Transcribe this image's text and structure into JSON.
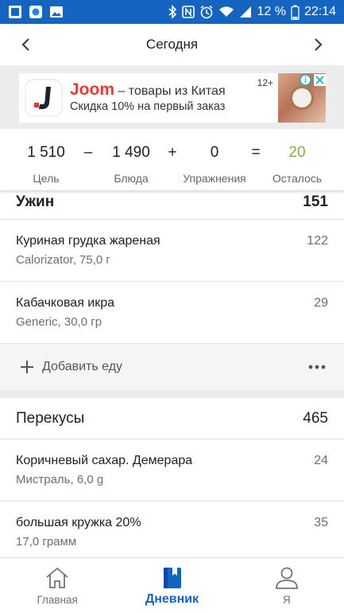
{
  "status_bar": {
    "battery_percent": "12 %",
    "time": "22:14",
    "left_icons": [
      "blue-square-icon",
      "app-badge-icon",
      "image-icon"
    ],
    "right_icons": [
      "bluetooth-icon",
      "nfc-icon",
      "alarm-icon",
      "wifi-icon",
      "signal-icon",
      "battery-icon"
    ]
  },
  "header": {
    "title": "Сегодня",
    "prev_icon": "chevron-left-icon",
    "next_icon": "chevron-right-icon"
  },
  "ad": {
    "brand": "Joom",
    "line1_rest": " – товары из Китая",
    "line2": "Скидка 10% на первый заказ",
    "age": "12+"
  },
  "summary": {
    "goal": "1 510",
    "goal_label": "Цель",
    "op_minus": "–",
    "food": "1 490",
    "food_label": "Блюда",
    "op_plus": "+",
    "exercise": "0",
    "exercise_label": "Упражнения",
    "op_equals": "=",
    "remaining": "20",
    "remaining_label": "Осталось",
    "remaining_color": "#7cb342"
  },
  "dinner": {
    "title": "Ужин",
    "total": "151",
    "items": [
      {
        "name": "Куриная грудка жареная",
        "detail": "Calorizator, 75,0 г",
        "calories": "122"
      },
      {
        "name": "Кабачковая икра",
        "detail": "Generic, 30,0 гр",
        "calories": "29"
      }
    ],
    "add_label": "Добавить еду"
  },
  "snacks": {
    "title": "Перекусы",
    "total": "465",
    "items": [
      {
        "name": "Коричневый сахар. Демерара",
        "detail": "Мистраль, 6,0 g",
        "calories": "24"
      },
      {
        "name": "большая кружка 20%",
        "detail": "17,0 грамм",
        "calories": "35"
      }
    ]
  },
  "bottom_nav": [
    {
      "label": "Главная",
      "icon": "home-icon",
      "active": false
    },
    {
      "label": "Дневник",
      "icon": "diary-icon",
      "active": true
    },
    {
      "label": "Я",
      "icon": "profile-icon",
      "active": false
    }
  ],
  "colors": {
    "status_bar": "#1565c0",
    "accent": "#1565c0",
    "ad_brand": "#e53935"
  }
}
